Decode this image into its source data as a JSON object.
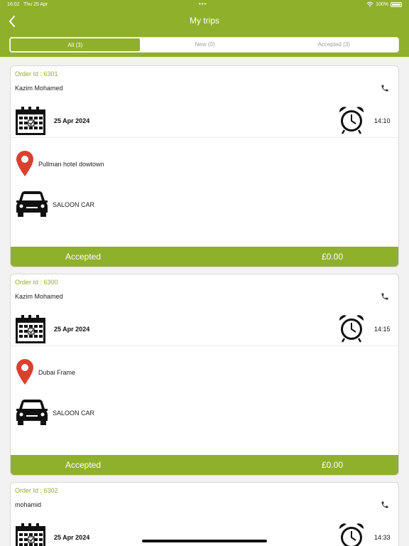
{
  "status_bar": {
    "time": "16:02",
    "date": "Thu 25 Apr",
    "battery": "100%"
  },
  "header": {
    "title": "My trips"
  },
  "tabs": [
    {
      "label": "All (3)",
      "active": true
    },
    {
      "label": "New (0)",
      "active": false
    },
    {
      "label": "Accepted (3)",
      "active": false
    }
  ],
  "trips": [
    {
      "order_id": "Order Id : 6301",
      "customer": "Kazim Mohamed",
      "date": "25 Apr 2024",
      "time": "14:10",
      "location": "Pullman hotel dowtown",
      "vehicle": "SALOON CAR",
      "status": "Accepted",
      "price": "£0.00"
    },
    {
      "order_id": "Order Id : 6300",
      "customer": "Kazim Mohamed",
      "date": "25 Apr 2024",
      "time": "14:15",
      "location": "Dubai Frame",
      "vehicle": "SALOON CAR",
      "status": "Accepted",
      "price": "£0.00"
    },
    {
      "order_id": "Order Id : 6302",
      "customer": "mohamid",
      "date": "25 Apr 2024",
      "time": "14:33",
      "location": "",
      "vehicle": "",
      "status": "",
      "price": ""
    }
  ],
  "colors": {
    "accent": "#8fb02a",
    "pin": "#d9412f"
  },
  "icons": {
    "back": "chevron-left-icon",
    "phone": "phone-icon",
    "calendar": "calendar-icon",
    "clock": "alarm-clock-icon",
    "location": "map-pin-icon",
    "vehicle": "car-icon"
  }
}
